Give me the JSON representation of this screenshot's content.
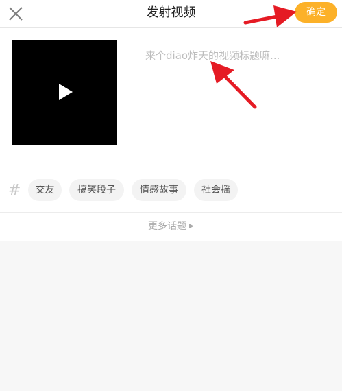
{
  "header": {
    "title": "发射视频",
    "confirm_label": "确定",
    "close_icon": "close-icon"
  },
  "video": {
    "play_icon": "play-icon"
  },
  "title_input": {
    "value": "",
    "placeholder": "来个diao炸天的视频标题嘛..."
  },
  "topics": {
    "icon": "hash-icon",
    "tags": [
      "交友",
      "搞笑段子",
      "情感故事",
      "社会摇"
    ],
    "more_label": "更多话题"
  },
  "colors": {
    "accent": "#fcb129",
    "annotation_red": "#e51b24"
  }
}
